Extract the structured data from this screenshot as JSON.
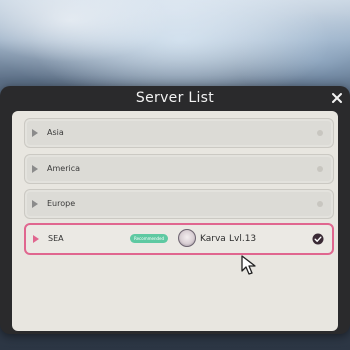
{
  "dialog": {
    "title": "Server List",
    "close_label": "×"
  },
  "servers": [
    {
      "name": "Asia",
      "selected": false
    },
    {
      "name": "America",
      "selected": false
    },
    {
      "name": "Europe",
      "selected": false
    },
    {
      "name": "SEA",
      "selected": true,
      "badge": "Recommended",
      "player_name": "Karva",
      "player_level": "Lvl.13"
    }
  ],
  "colors": {
    "accent": "#e0668f",
    "badge": "#5ec9a2",
    "panel": "#2a2a2c",
    "list_background": "#e8e6e0"
  },
  "icons": {
    "close": "close-icon",
    "row_arrow": "chevron-right-icon",
    "check": "check-circle-icon",
    "avatar": "player-avatar",
    "cursor": "mouse-pointer-icon"
  }
}
